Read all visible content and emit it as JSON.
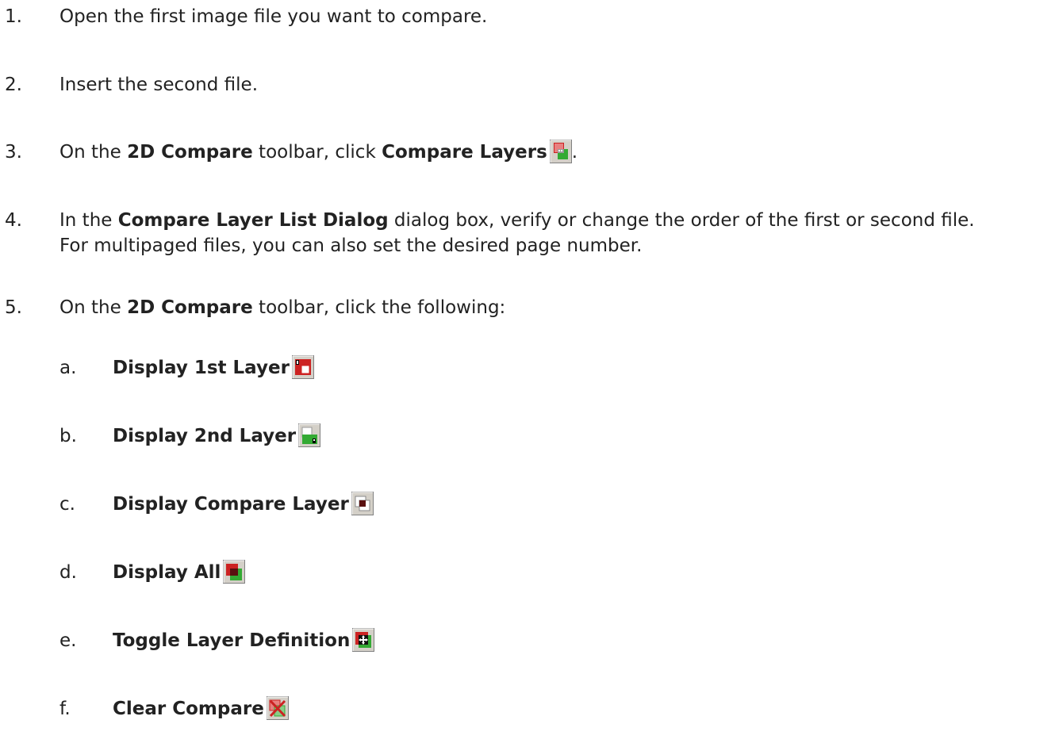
{
  "steps": [
    {
      "number": "1.",
      "text": "Open the first image file you want to compare."
    },
    {
      "number": "2.",
      "text": "Insert the second file."
    },
    {
      "number": "3.",
      "prefix": "On the ",
      "bold1": "2D Compare",
      "middle": " toolbar, click ",
      "bold2": "Compare Layers",
      "suffix": ".",
      "icon": "compare-layers-icon"
    },
    {
      "number": "4.",
      "prefix": "In the ",
      "bold1": "Compare Layer List Dialog",
      "suffix": " dialog box, verify or change the order of the first or second file.",
      "line2": "For multipaged files, you can also set the desired page number."
    },
    {
      "number": "5.",
      "prefix": "On the ",
      "bold1": "2D Compare",
      "suffix": " toolbar, click the following:"
    }
  ],
  "substeps": [
    {
      "letter": "a.",
      "label": "Display 1st Layer",
      "icon": "display-1st-layer-icon"
    },
    {
      "letter": "b.",
      "label": "Display 2nd Layer",
      "icon": "display-2nd-layer-icon"
    },
    {
      "letter": "c.",
      "label": "Display Compare Layer",
      "icon": "display-compare-layer-icon"
    },
    {
      "letter": "d.",
      "label": "Display All",
      "icon": "display-all-icon"
    },
    {
      "letter": "e.",
      "label": "Toggle Layer Definition",
      "icon": "toggle-layer-definition-icon"
    },
    {
      "letter": "f.",
      "label": "Clear Compare",
      "icon": "clear-compare-icon"
    }
  ],
  "colors": {
    "text": "#222222",
    "icon_red": "#cc2222",
    "icon_green": "#33aa33",
    "icon_dark": "#5a1010",
    "button_face": "#d4d0c8"
  }
}
